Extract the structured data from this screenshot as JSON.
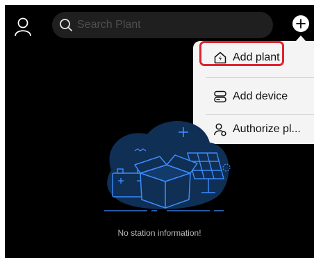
{
  "header": {
    "profile_icon": "person-icon",
    "search": {
      "icon": "search-icon",
      "placeholder": "Search Plant"
    },
    "add_icon": "plus-circle-icon"
  },
  "menu": {
    "items": [
      {
        "label": "Add plant",
        "icon": "house-bolt-icon",
        "highlighted": true
      },
      {
        "label": "Add device",
        "icon": "device-stack-icon",
        "highlighted": false
      },
      {
        "label": "Authorize pl...",
        "icon": "user-share-icon",
        "highlighted": false
      }
    ]
  },
  "empty_state": {
    "illustration": "box-battery-solar-panel-illustration",
    "message": "No station information!"
  },
  "colors": {
    "background": "#000000",
    "search_bg": "#1f1f1f",
    "menu_bg": "#f4f4f4",
    "highlight": "#e0222e",
    "illustration_blob": "#0f2f55",
    "illustration_accent": "#3c8cff"
  }
}
